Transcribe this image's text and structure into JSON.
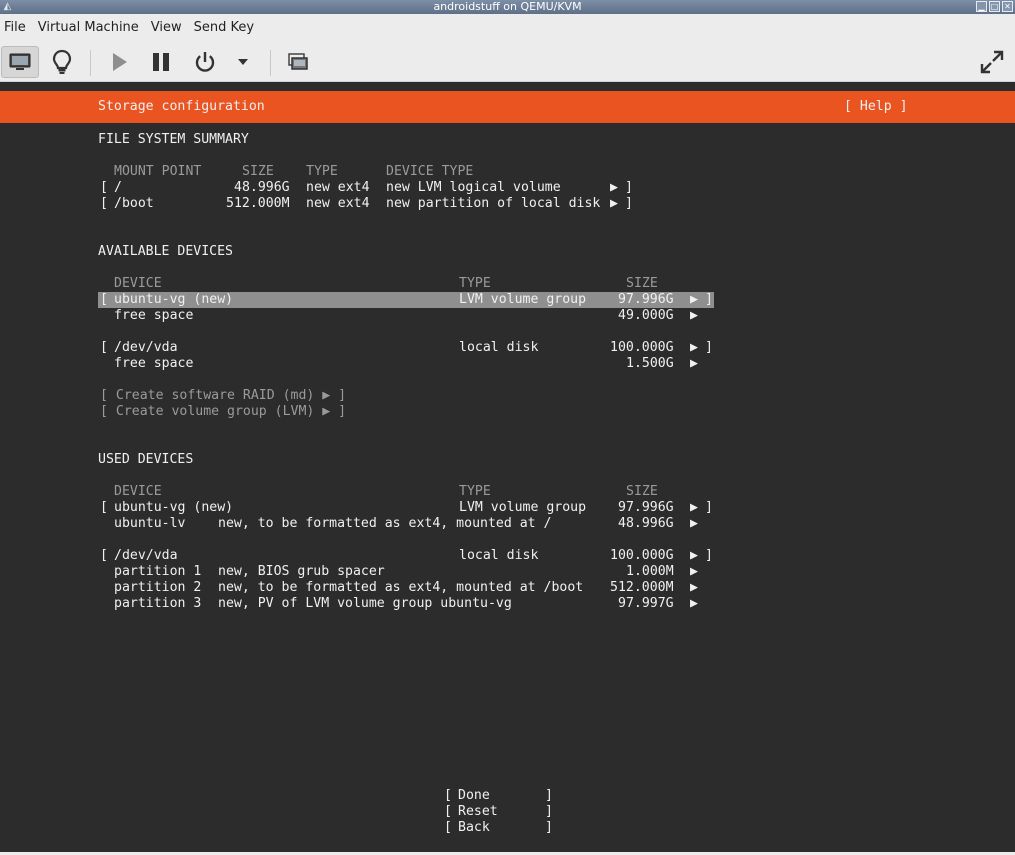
{
  "window": {
    "title": "androidstuff on QEMU/KVM"
  },
  "menubar": {
    "items": [
      "File",
      "Virtual Machine",
      "View",
      "Send Key"
    ]
  },
  "toolbar": {
    "buttons": [
      "console-icon",
      "lightbulb-icon",
      "play-icon",
      "pause-icon",
      "power-icon",
      "dropdown-arrow-icon",
      "snapshot-icon",
      "fullscreen-icon"
    ]
  },
  "colors": {
    "ubuntu_orange": "#E95420",
    "console_bg": "#2C2C2C",
    "selected_row": "#8F8F8F"
  },
  "screen": {
    "title": "Storage configuration",
    "help": "[ Help ]",
    "fs_summary": {
      "heading": "FILE SYSTEM SUMMARY",
      "columns": [
        "MOUNT POINT",
        "SIZE",
        "TYPE",
        "DEVICE TYPE"
      ],
      "rows": [
        {
          "open": "[",
          "mount": "/",
          "size": "48.996G",
          "type": "new ext4",
          "device_type": "new LVM logical volume",
          "arrow": "▶",
          "close": "]"
        },
        {
          "open": "[",
          "mount": "/boot",
          "size": "512.000M",
          "type": "new ext4",
          "device_type": "new partition of local disk",
          "arrow": "▶",
          "close": "]"
        }
      ]
    },
    "available": {
      "heading": "AVAILABLE DEVICES",
      "columns": [
        "DEVICE",
        "TYPE",
        "SIZE"
      ],
      "rows": [
        {
          "open": "[",
          "device": "ubuntu-vg (new)",
          "type": "LVM volume group",
          "size": "97.996G",
          "arrow": "▶",
          "close": "]"
        },
        {
          "device": "free space",
          "size": "49.000G",
          "arrow": "▶"
        },
        {
          "open": "[",
          "device": "/dev/vda",
          "type": "local disk",
          "size": "100.000G",
          "arrow": "▶",
          "close": "]"
        },
        {
          "device": "free space",
          "size": "1.500G",
          "arrow": "▶"
        }
      ],
      "actions": [
        "[ Create software RAID (md) ▶ ]",
        "[ Create volume group (LVM) ▶ ]"
      ]
    },
    "used": {
      "heading": "USED DEVICES",
      "columns": [
        "DEVICE",
        "TYPE",
        "SIZE"
      ],
      "rows": [
        {
          "open": "[",
          "device": "ubuntu-vg (new)",
          "type": "LVM volume group",
          "size": "97.996G",
          "arrow": "▶",
          "close": "]"
        },
        {
          "device": "ubuntu-lv",
          "type": "new, to be formatted as ext4, mounted at /",
          "size": "48.996G",
          "arrow": "▶"
        },
        {
          "open": "[",
          "device": "/dev/vda",
          "type": "local disk",
          "size": "100.000G",
          "arrow": "▶",
          "close": "]"
        },
        {
          "device": "partition 1",
          "type": "new, BIOS grub spacer",
          "size": "1.000M",
          "arrow": "▶"
        },
        {
          "device": "partition 2",
          "type": "new, to be formatted as ext4, mounted at /boot",
          "size": "512.000M",
          "arrow": "▶"
        },
        {
          "device": "partition 3",
          "type": "new, PV of LVM volume group ubuntu-vg",
          "size": "97.997G",
          "arrow": "▶"
        }
      ]
    },
    "buttons": [
      {
        "open": "[",
        "label": "Done",
        "close": "]"
      },
      {
        "open": "[",
        "label": "Reset",
        "close": "]"
      },
      {
        "open": "[",
        "label": "Back",
        "close": "]"
      }
    ]
  }
}
